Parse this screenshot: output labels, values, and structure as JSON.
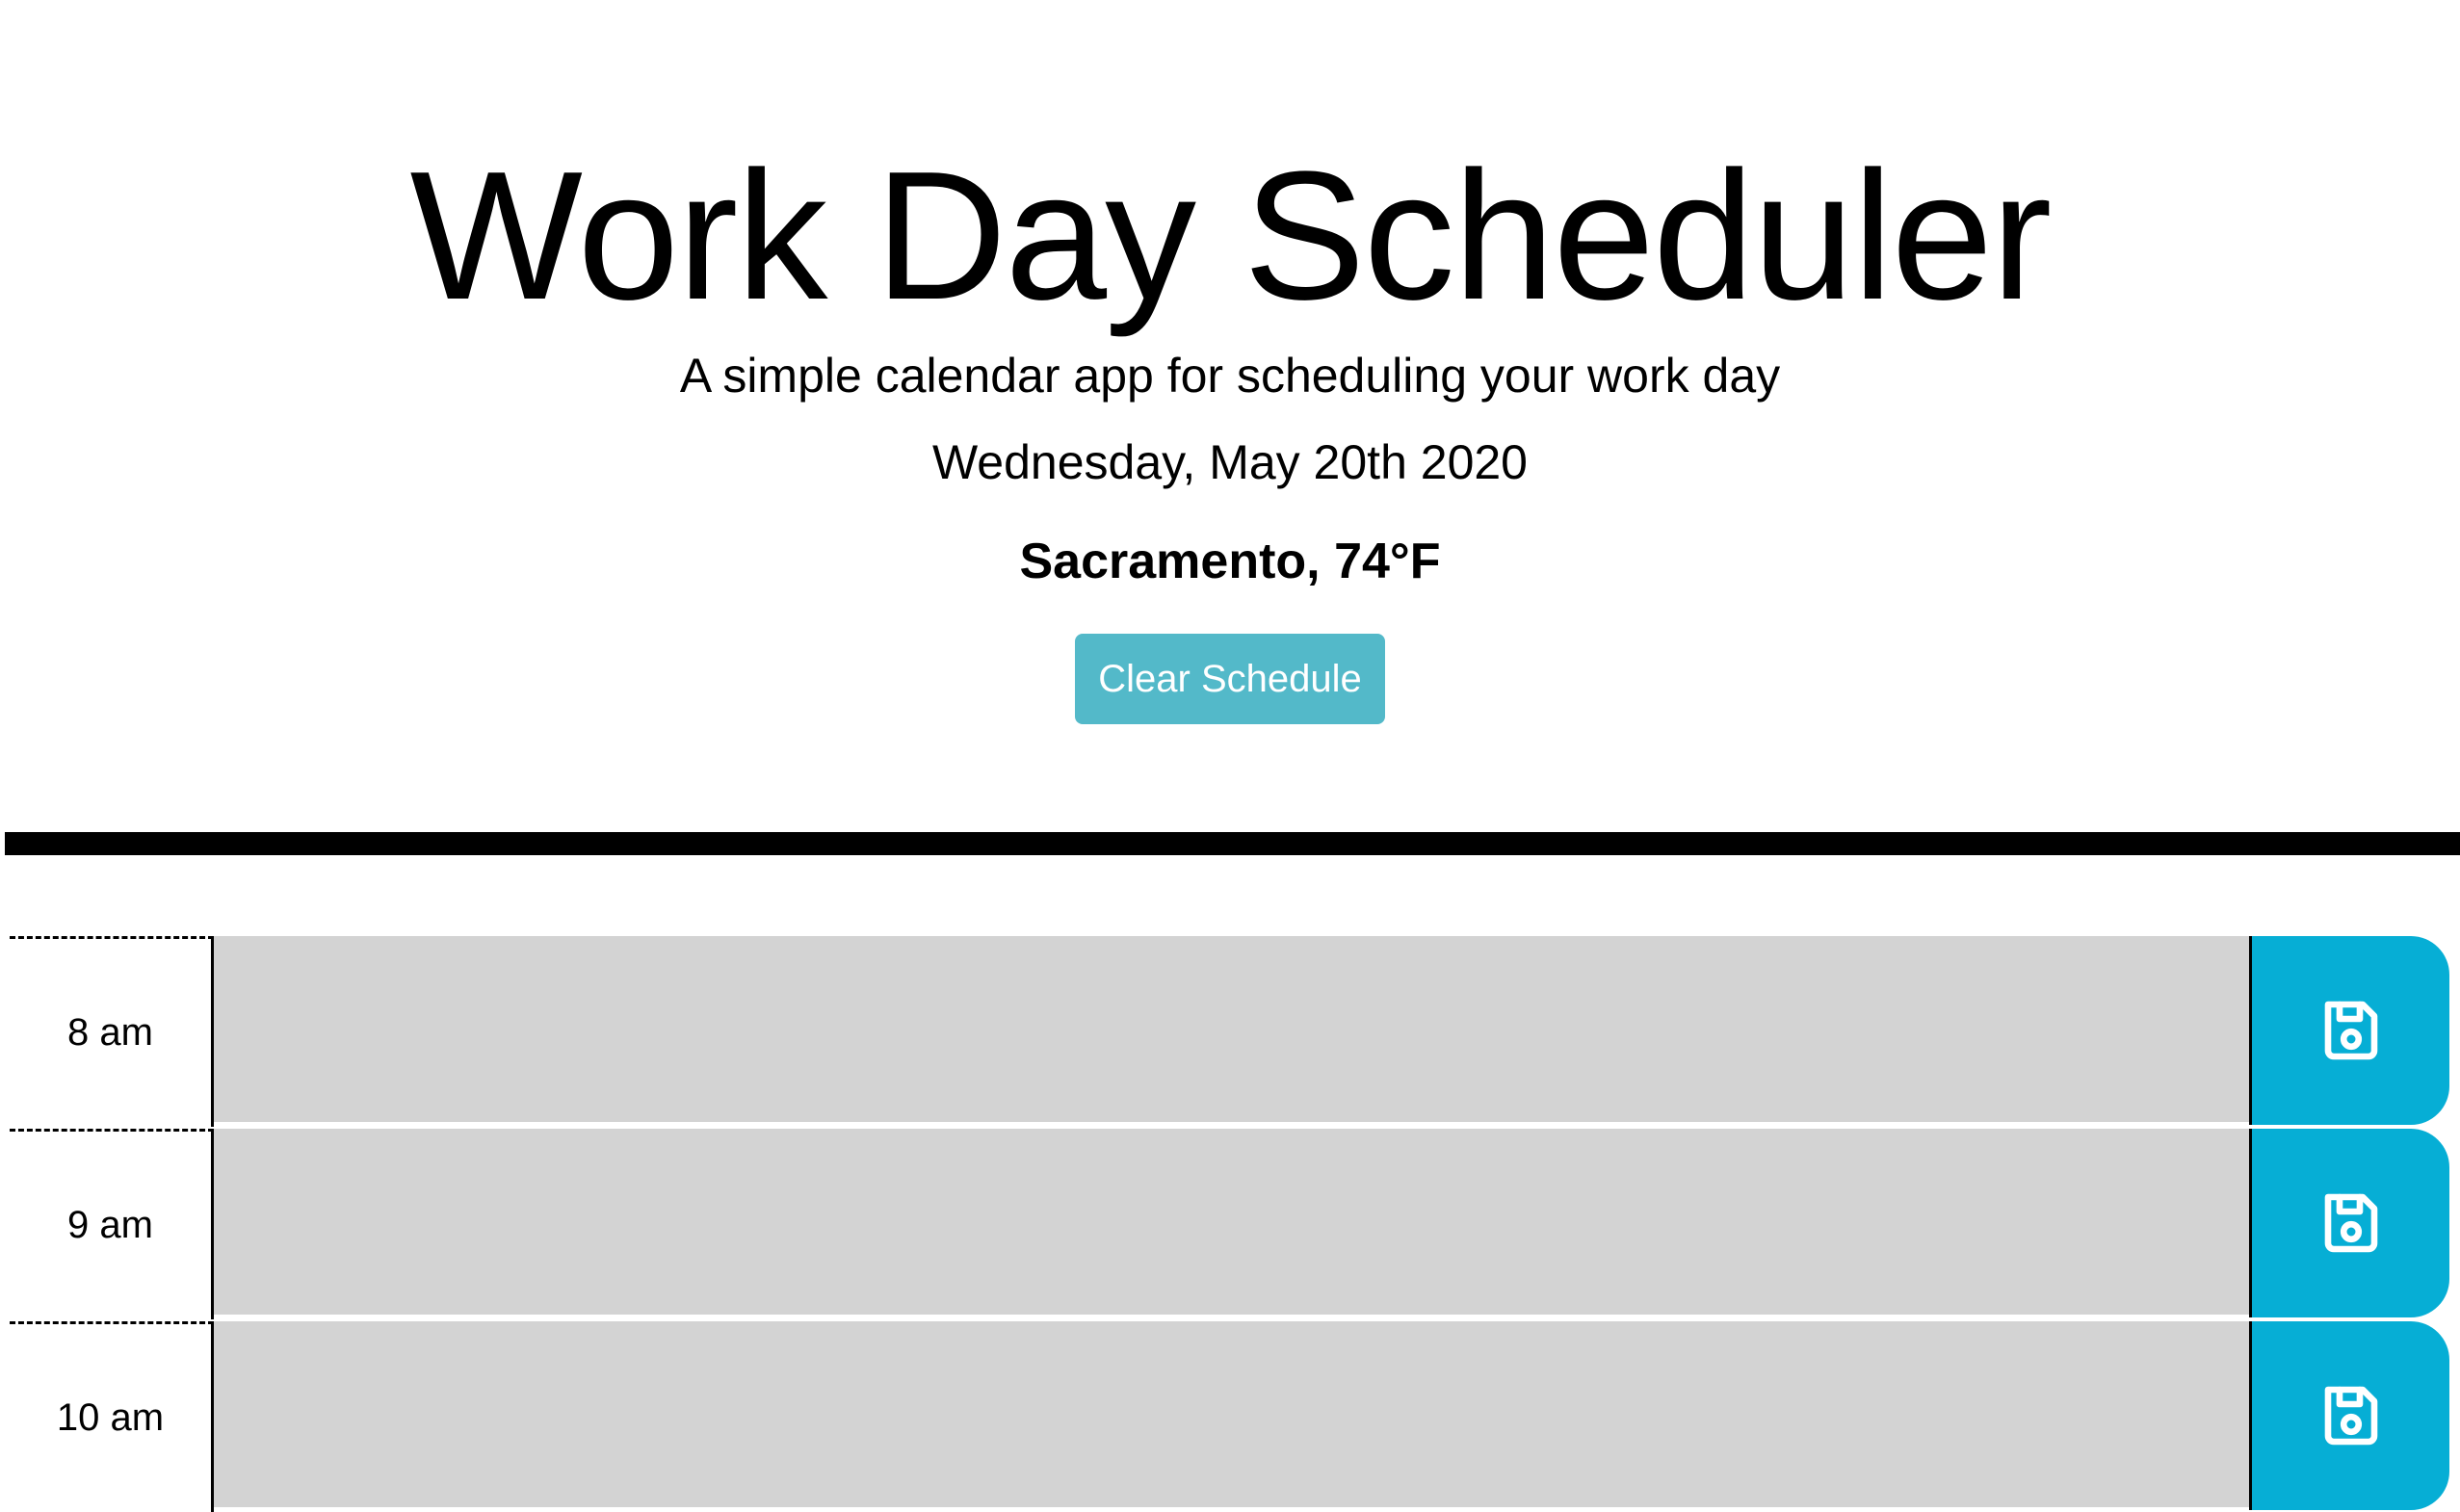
{
  "header": {
    "title": "Work Day Scheduler",
    "lead": "A simple calendar app for scheduling your work day",
    "date": "Wednesday, May 20th 2020",
    "weather": "Sacramento, 74°F",
    "clear_label": "Clear Schedule"
  },
  "colors": {
    "clear_button": "#53b9c9",
    "save_button": "#06aed5",
    "past_row": "#d3d3d3"
  },
  "schedule": {
    "rows": [
      {
        "hour": "8 am",
        "text": ""
      },
      {
        "hour": "9 am",
        "text": ""
      },
      {
        "hour": "10 am",
        "text": ""
      }
    ]
  },
  "icons": {
    "save": "floppy-disk-icon"
  }
}
